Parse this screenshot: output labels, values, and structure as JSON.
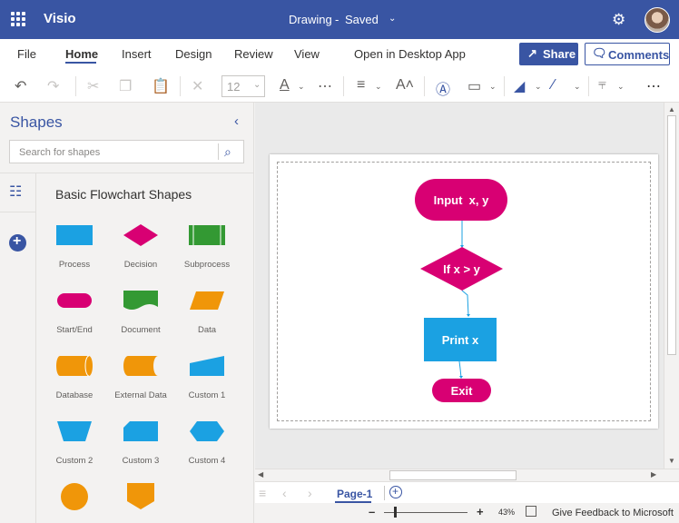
{
  "app": {
    "name": "Visio",
    "doc_title": "Drawing",
    "doc_separator": "-",
    "doc_status": "Saved"
  },
  "tabs": [
    "File",
    "Home",
    "Insert",
    "Design",
    "Review",
    "View",
    "Open in Desktop App"
  ],
  "active_tab": "Home",
  "share_label": "Share",
  "comments_label": "Comments",
  "toolbar": {
    "font_size": "12"
  },
  "panel": {
    "title": "Shapes",
    "search_placeholder": "Search for shapes",
    "stencil_title": "Basic Flowchart Shapes",
    "shapes": [
      {
        "label": "Process",
        "icon": "process-shape",
        "color": "#1ba1e2"
      },
      {
        "label": "Decision",
        "icon": "decision-shape",
        "color": "#d80073"
      },
      {
        "label": "Subprocess",
        "icon": "subprocess-shape",
        "color": "#339933"
      },
      {
        "label": "Start/End",
        "icon": "start-end-shape",
        "color": "#d80073"
      },
      {
        "label": "Document",
        "icon": "document-shape",
        "color": "#339933"
      },
      {
        "label": "Data",
        "icon": "data-shape",
        "color": "#f09609"
      },
      {
        "label": "Database",
        "icon": "database-shape",
        "color": "#f09609"
      },
      {
        "label": "External Data",
        "icon": "external-data-shape",
        "color": "#f09609"
      },
      {
        "label": "Custom 1",
        "icon": "custom-1-shape",
        "color": "#1ba1e2"
      },
      {
        "label": "Custom 2",
        "icon": "custom-2-shape",
        "color": "#1ba1e2"
      },
      {
        "label": "Custom 3",
        "icon": "custom-3-shape",
        "color": "#1ba1e2"
      },
      {
        "label": "Custom 4",
        "icon": "custom-4-shape",
        "color": "#1ba1e2"
      },
      {
        "label": "",
        "icon": "circle-shape",
        "color": "#f09609"
      },
      {
        "label": "",
        "icon": "off-page-shape",
        "color": "#f09609"
      }
    ]
  },
  "diagram": {
    "start_label": "Input  x, y",
    "decision_label": "If x > y",
    "process_label": "Print x",
    "end_label": "Exit",
    "colors": {
      "magenta": "#d80073",
      "blue": "#1ba1e2",
      "connector": "#1ba1e2"
    }
  },
  "page_tab": "Page-1",
  "zoom": "43%",
  "feedback": "Give Feedback to Microsoft"
}
